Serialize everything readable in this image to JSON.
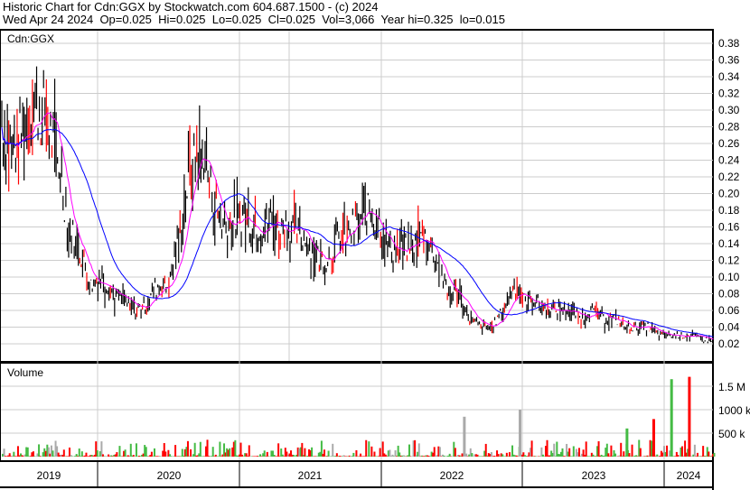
{
  "header": {
    "line1": "Historic Chart for Cdn:GGX by Stockwatch.com 604.687.1500 - (c) 2024",
    "line2": "Wed Apr 24 2024  Op=0.025  Hi=0.025  Lo=0.025  Cl=0.025  Vol=3,066  Year hi=0.325  lo=0.015"
  },
  "colors": {
    "bar": "#000000",
    "ma_short": "#ff00ff",
    "ma_long": "#0000ff",
    "vol_up": "#44bb44",
    "vol_down": "#ff0000",
    "vol_flat": "#aaaaaa"
  },
  "chart_data": [
    {
      "type": "line",
      "title": "Cdn:GGX",
      "ylim": [
        0,
        0.39
      ],
      "yticks": [
        "0.02",
        "0.04",
        "0.06",
        "0.08",
        "0.10",
        "0.12",
        "0.14",
        "0.16",
        "0.18",
        "0.20",
        "0.22",
        "0.24",
        "0.26",
        "0.28",
        "0.30",
        "0.32",
        "0.34",
        "0.36",
        "0.38"
      ],
      "start": "2019-01",
      "monthly_close": [
        0.28,
        0.25,
        0.28,
        0.3,
        0.3,
        0.24,
        0.16,
        0.13,
        0.09,
        0.1,
        0.08,
        0.07,
        0.06,
        0.07,
        0.09,
        0.09,
        0.15,
        0.24,
        0.25,
        0.19,
        0.16,
        0.17,
        0.17,
        0.16,
        0.17,
        0.16,
        0.16,
        0.15,
        0.13,
        0.12,
        0.14,
        0.15,
        0.17,
        0.18,
        0.16,
        0.13,
        0.13,
        0.14,
        0.15,
        0.12,
        0.08,
        0.08,
        0.05,
        0.04,
        0.04,
        0.06,
        0.09,
        0.07,
        0.07,
        0.06,
        0.06,
        0.06,
        0.05,
        0.06,
        0.05,
        0.05,
        0.04,
        0.04,
        0.04,
        0.03,
        0.03,
        0.03,
        0.03,
        0.025
      ]
    },
    {
      "type": "bar",
      "title": "Volume",
      "yticks": [
        "500 k",
        "1000 k",
        "1.5 M"
      ],
      "spikes_month_index_thousands": [
        [
          41.4,
          850,
          "flat"
        ],
        [
          46.4,
          1000,
          "flat"
        ],
        [
          56,
          600,
          "up"
        ],
        [
          58.4,
          800,
          "down"
        ],
        [
          60,
          1650,
          "up"
        ],
        [
          61.6,
          1700,
          "down"
        ]
      ]
    },
    {
      "xticks": [
        "2019",
        "2020",
        "2021",
        "2022",
        "2023",
        "2024"
      ]
    }
  ]
}
